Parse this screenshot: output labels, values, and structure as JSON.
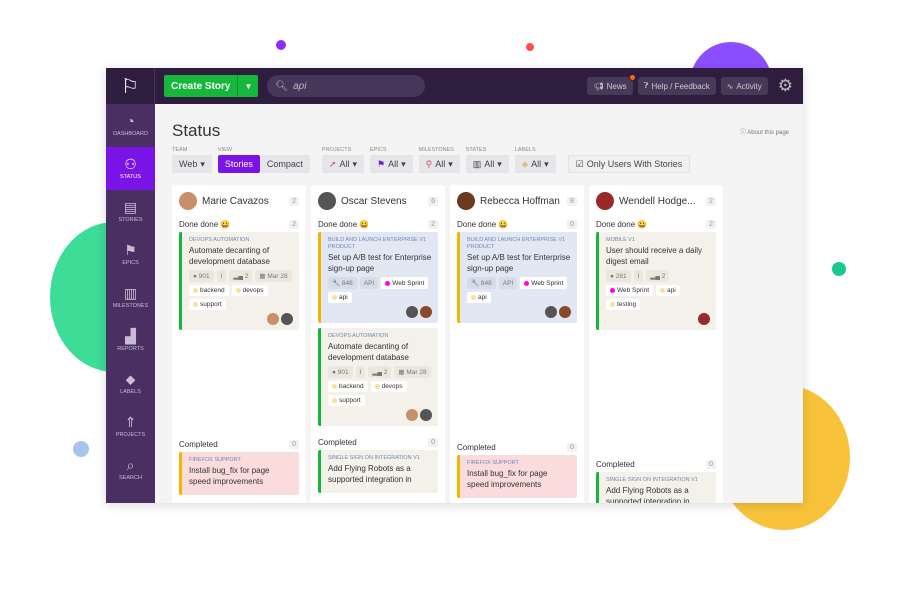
{
  "colors": {
    "topbar": "#2e1d3e",
    "sidebar": "#4a2f63",
    "accent": "#7a14e6",
    "create": "#15b83b"
  },
  "topbar": {
    "logo_icon": "flag-logo-icon",
    "create_label": "Create Story",
    "search_value": "api",
    "news": "News",
    "help": "Help / Feedback",
    "activity": "Activity"
  },
  "sidebar": [
    {
      "label": "DASHBOARD",
      "icon": "◔"
    },
    {
      "label": "STATUS",
      "icon": "⚇",
      "active": true
    },
    {
      "label": "STORIES",
      "icon": "▤"
    },
    {
      "label": "EPICS",
      "icon": "⚑"
    },
    {
      "label": "MILESTONES",
      "icon": "▥"
    },
    {
      "label": "REPORTS",
      "icon": "▟"
    },
    {
      "label": "LABELS",
      "icon": "⬥"
    },
    {
      "label": "PROJECTS",
      "icon": "⇑"
    },
    {
      "label": "SEARCH",
      "icon": "⌕"
    }
  ],
  "page": {
    "title": "Status",
    "about": "About this page"
  },
  "filters": {
    "team_label": "TEAM",
    "team": "Web",
    "view_label": "VIEW",
    "view_stories": "Stories",
    "view_compact": "Compact",
    "projects_label": "PROJECTS",
    "epics_label": "EPICS",
    "milestones_label": "MILESTONES",
    "states_label": "STATES",
    "labels_label": "LABELS",
    "all": "All",
    "only_users": "Only Users With Stories"
  },
  "columns": [
    {
      "name": "Marie Cavazos",
      "count": "2",
      "avatar": "#c8906a",
      "sections": [
        {
          "title": "Done done 😀",
          "count": "2",
          "cards": [
            {
              "epic": "DEVOPS AUTOMATION",
              "title": "Automate decanting of development database",
              "bar": "green",
              "bg": "",
              "tags": [
                [
                  "● 901",
                  ""
                ],
                [
                  "I",
                  ""
                ],
                [
                  "▂▄ 2",
                  ""
                ],
                [
                  "▦ Mar 28",
                  ""
                ],
                [
                  "backend",
                  "w",
                  "#f7e09a"
                ],
                [
                  "devops",
                  "w",
                  "#f7e09a"
                ],
                [
                  "support",
                  "w",
                  "#f7e09a"
                ]
              ],
              "avatars": [
                "#c8906a",
                "#555"
              ]
            }
          ]
        },
        {
          "title": "Completed",
          "count": "0",
          "cards": [
            {
              "epic": "FIREFOX SUPPORT",
              "title": "Install bug_fix for page speed improvements",
              "bar": "y",
              "bg": "red",
              "tags": [],
              "avatars": []
            }
          ]
        }
      ]
    },
    {
      "name": "Oscar Stevens",
      "count": "6",
      "avatar": "#555",
      "sections": [
        {
          "title": "Done done 😀",
          "count": "2",
          "cards": [
            {
              "epic": "BUILD AND LAUNCH ENTERPRISE V1 PRODUCT",
              "title": "Set up A/B test for Enterprise sign-up page",
              "bar": "y",
              "bg": "blue",
              "tags": [
                [
                  "🔧 848",
                  ""
                ],
                [
                  "API",
                  ""
                ],
                [
                  "Web Sprint",
                  "w",
                  "#ff00e0"
                ],
                [
                  "api",
                  "w",
                  "#f7e09a"
                ]
              ],
              "avatars": [
                "#555",
                "#8a4a2a"
              ]
            },
            {
              "epic": "DEVOPS AUTOMATION",
              "title": "Automate decanting of development database",
              "bar": "green",
              "bg": "",
              "tags": [
                [
                  "● 901",
                  ""
                ],
                [
                  "I",
                  ""
                ],
                [
                  "▂▄ 2",
                  ""
                ],
                [
                  "▦ Mar 28",
                  ""
                ],
                [
                  "backend",
                  "w",
                  "#f7e09a"
                ],
                [
                  "devops",
                  "w",
                  "#f7e09a"
                ],
                [
                  "support",
                  "w",
                  "#f7e09a"
                ]
              ],
              "avatars": [
                "#c8906a",
                "#555"
              ]
            }
          ]
        },
        {
          "title": "Completed",
          "count": "0",
          "cards": [
            {
              "epic": "SINGLE SIGN ON INTEGRATION V1",
              "title": "Add Flying Robots as a supported integration in",
              "bar": "green",
              "bg": "",
              "tags": [],
              "avatars": []
            }
          ]
        }
      ]
    },
    {
      "name": "Rebecca Hoffman",
      "count": "8",
      "avatar": "#6a3a20",
      "sections": [
        {
          "title": "Done done 😀",
          "count": "0",
          "cards": [
            {
              "epic": "BUILD AND LAUNCH ENTERPRISE V1 PRODUCT",
              "title": "Set up A/B test for Enterprise sign-up page",
              "bar": "y",
              "bg": "blue",
              "tags": [
                [
                  "🔧 848",
                  ""
                ],
                [
                  "API",
                  ""
                ],
                [
                  "Web Sprint",
                  "w",
                  "#ff00e0"
                ],
                [
                  "api",
                  "w",
                  "#f7e09a"
                ]
              ],
              "avatars": [
                "#555",
                "#8a4a2a"
              ]
            }
          ]
        },
        {
          "title": "Completed",
          "count": "0",
          "cards": [
            {
              "epic": "FIREFOX SUPPORT",
              "title": "Install bug_fix for page speed improvements",
              "bar": "y",
              "bg": "red",
              "tags": [],
              "avatars": []
            }
          ]
        }
      ]
    },
    {
      "name": "Wendell Hodge...",
      "count": "2",
      "avatar": "#9a2a2a",
      "sections": [
        {
          "title": "Done done 😀",
          "count": "2",
          "cards": [
            {
              "epic": "MOBILE V1",
              "title": "User should receive a daily digest email",
              "bar": "green",
              "bg": "",
              "tags": [
                [
                  "● 281",
                  ""
                ],
                [
                  "I",
                  ""
                ],
                [
                  "▂▄ 2",
                  ""
                ],
                [
                  "Web Sprint",
                  "w",
                  "#ff00e0"
                ],
                [
                  "api",
                  "w",
                  "#f7e09a"
                ],
                [
                  "testing",
                  "w",
                  "#f7e09a"
                ]
              ],
              "avatars": [
                "#9a2a2a"
              ]
            }
          ]
        },
        {
          "title": "Completed",
          "count": "0",
          "cards": [
            {
              "epic": "SINGLE SIGN ON INTEGRATION V1",
              "title": "Add Flying Robots as a supported integration in",
              "bar": "green",
              "bg": "",
              "tags": [],
              "avatars": []
            }
          ]
        }
      ]
    }
  ]
}
